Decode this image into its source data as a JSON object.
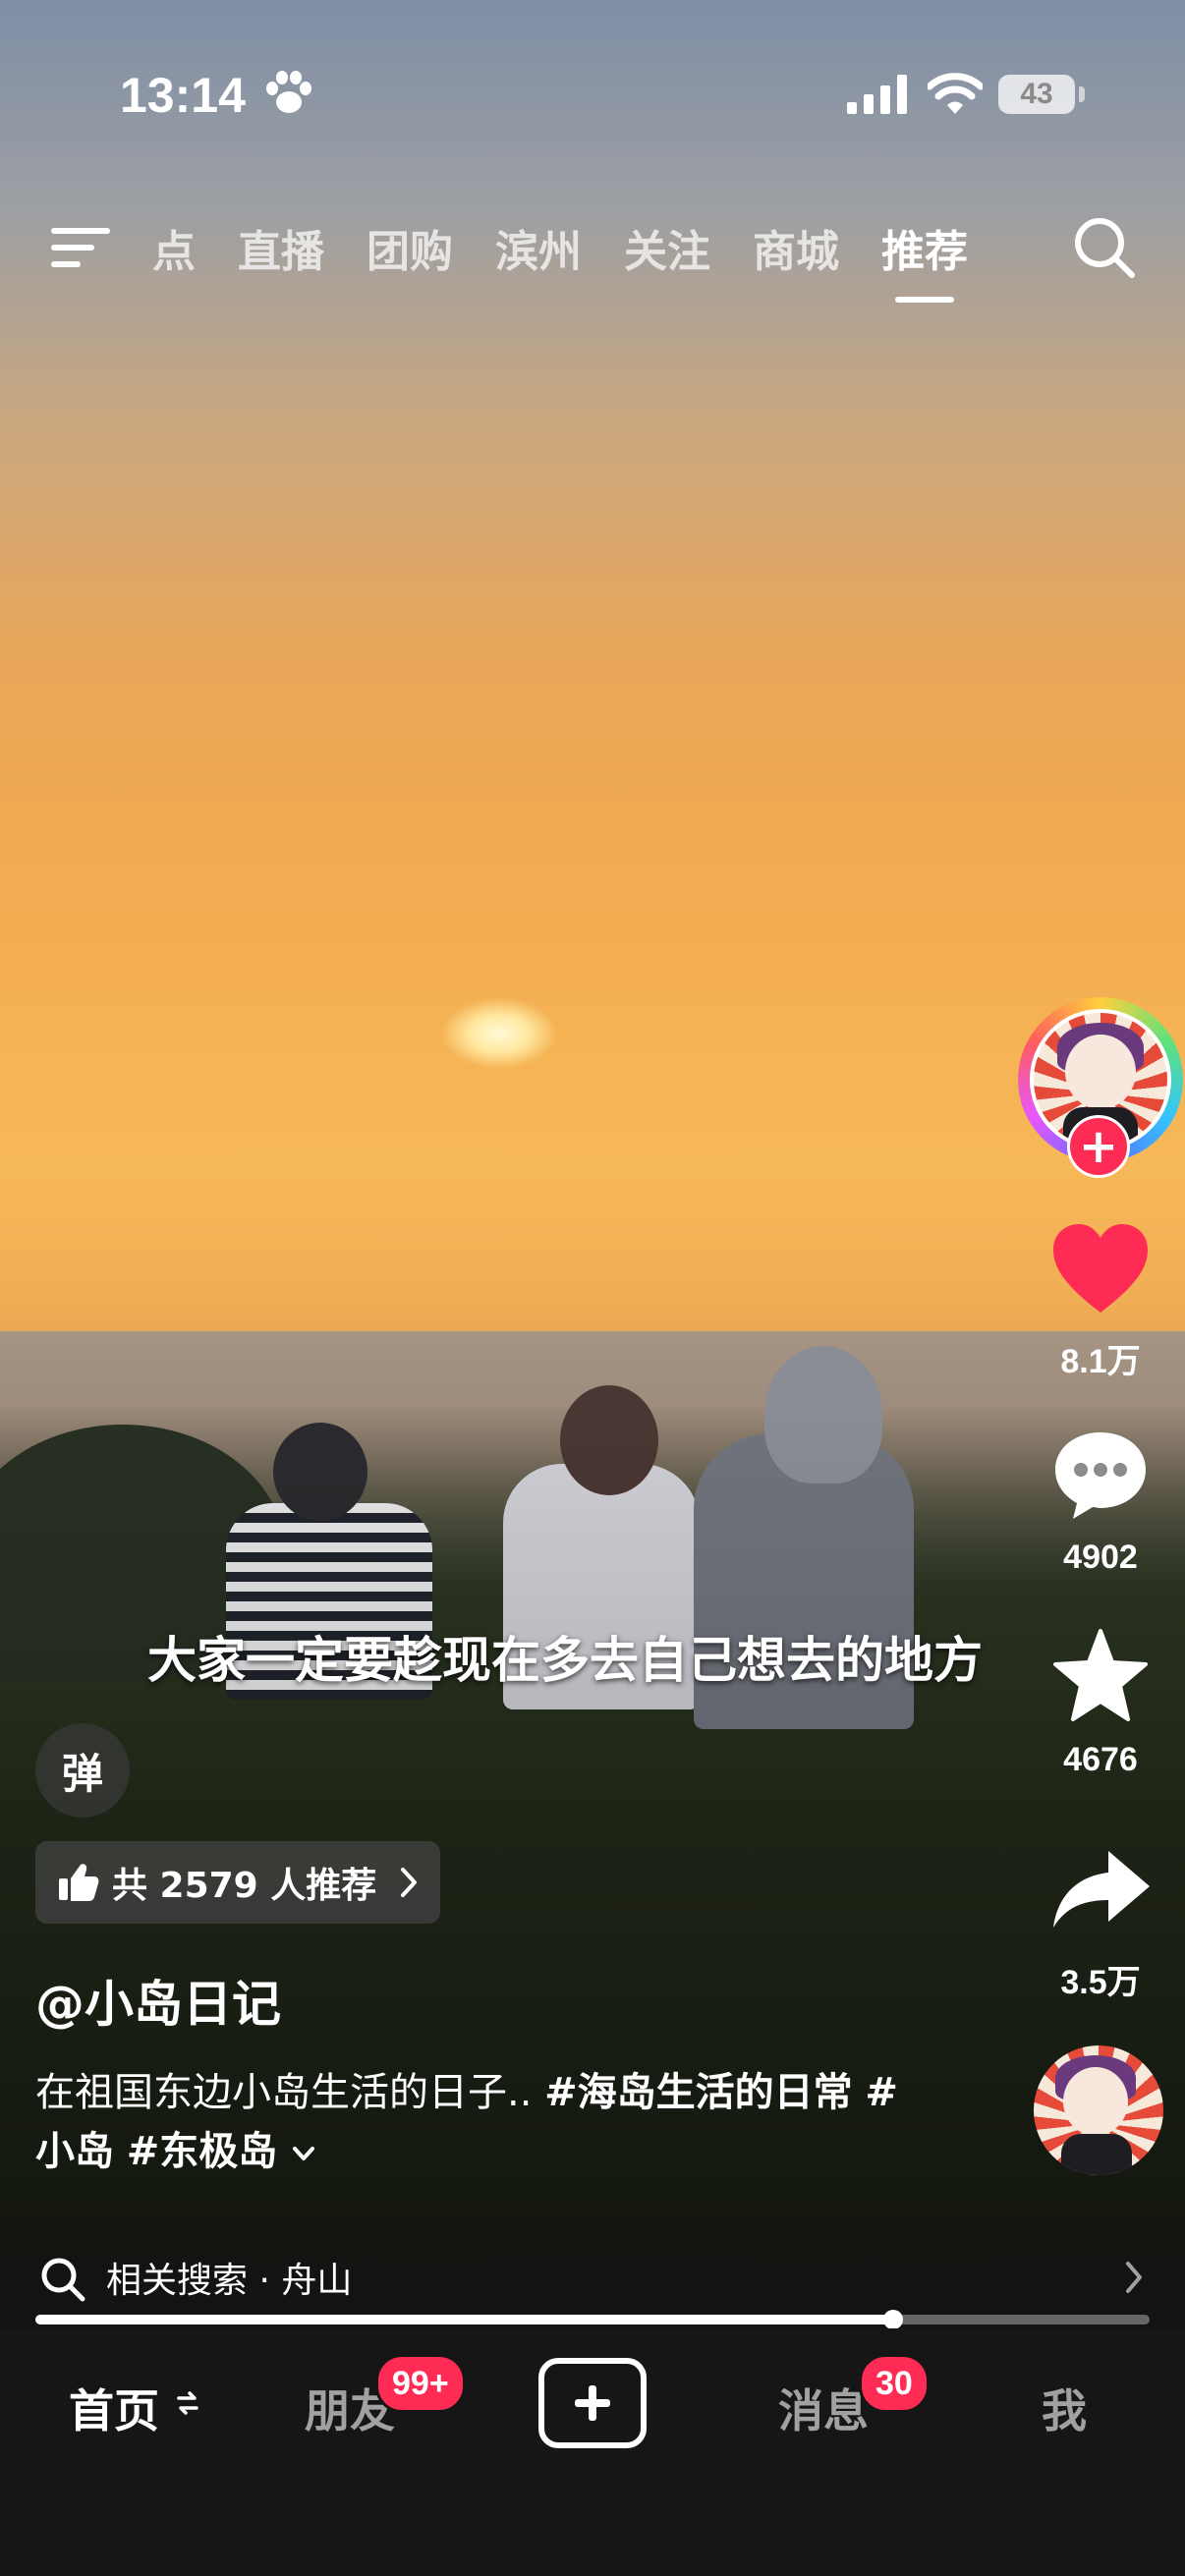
{
  "status_bar": {
    "time": "13:14",
    "battery": "43"
  },
  "top_nav": {
    "tabs": [
      {
        "label": "点"
      },
      {
        "label": "直播"
      },
      {
        "label": "团购"
      },
      {
        "label": "滨州"
      },
      {
        "label": "关注"
      },
      {
        "label": "商城"
      },
      {
        "label": "推荐",
        "active": true
      }
    ]
  },
  "video": {
    "subtitle": "大家一定要趁现在多去自己想去的地方",
    "danmu_label": "弹",
    "recommend_label": "共 2579 人推荐",
    "author": "@小岛日记",
    "description_text": "在祖国东边小岛生活的日子.. ",
    "hashtags": [
      "#海岛生活的日常",
      "#小岛",
      "#东极岛"
    ],
    "progress_fraction": 0.77
  },
  "actions": {
    "likes": "8.1万",
    "comments": "4902",
    "favorites": "4676",
    "shares": "3.5万"
  },
  "related_search": {
    "label": "相关搜索 · 舟山"
  },
  "bottom_nav": {
    "home": "首页",
    "friends": "朋友",
    "friends_badge": "99+",
    "messages": "消息",
    "messages_badge": "30",
    "me": "我"
  },
  "colors": {
    "accent": "#fe2c55",
    "like": "#fe2c55"
  }
}
